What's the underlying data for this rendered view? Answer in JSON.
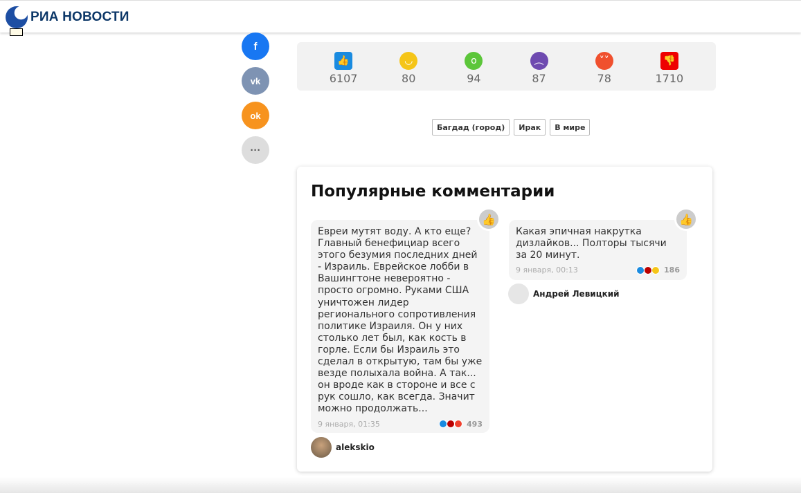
{
  "header": {
    "logo_text": "РИА НОВОСТИ"
  },
  "share": [
    {
      "icon": "f",
      "name": "facebook",
      "color": "#1877f2"
    },
    {
      "icon": "vk",
      "name": "vk",
      "color": "#7e93b3"
    },
    {
      "icon": "ok",
      "name": "odnoklassniki",
      "color": "#f7931e"
    },
    {
      "icon": "···",
      "name": "more",
      "color": "#ddd"
    }
  ],
  "reactions": [
    {
      "name": "like",
      "count": "6107",
      "color": "#1a8be0"
    },
    {
      "name": "laugh",
      "count": "80",
      "color": "#f5c518"
    },
    {
      "name": "wow",
      "count": "94",
      "color": "#5cc63a"
    },
    {
      "name": "sad",
      "count": "87",
      "color": "#6e4ab0"
    },
    {
      "name": "angry",
      "count": "78",
      "color": "#f0502e"
    },
    {
      "name": "dislike",
      "count": "1710",
      "color": "#e00"
    }
  ],
  "tags": [
    "Багдад (город)",
    "Ирак",
    "В мире"
  ],
  "comments_section": {
    "title": "Популярные комментарии",
    "comments": [
      {
        "text": "Евреи мутят воду. А кто еще? Главный бенефициар всего этого безумия последних дней - Израиль. Еврейское лобби в Вашингтоне невероятно - просто огромно. Руками США уничтожен лидер регионального сопротивления политике Израиля. Он у них столько лет был, как кость в горле. Если бы Израиль это сделал в открытую, там бы уже везде полыхала война. А так... он вроде как в стороне и все с рук сошло, как всегда. Значит можно продолжать...",
        "date": "9 января, 01:35",
        "count": "493",
        "author": "alekskio"
      },
      {
        "text": "Какая эпичная накрутка дизлайков... Полторы тысячи за 20 минут.",
        "date": "9 января, 00:13",
        "count": "186",
        "author": "Андрей Левицкий"
      }
    ]
  }
}
